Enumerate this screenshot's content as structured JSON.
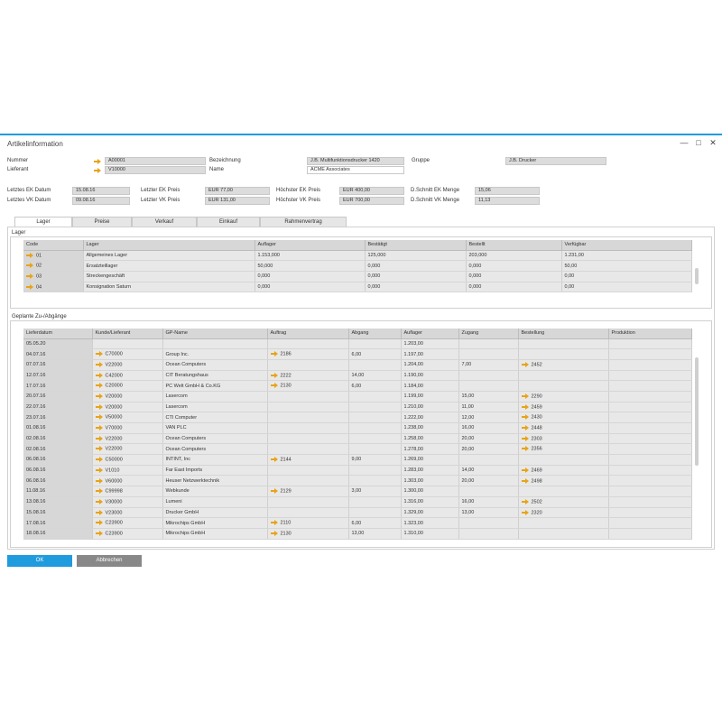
{
  "window": {
    "title": "Artikelinformation"
  },
  "header": {
    "nummer_label": "Nummer",
    "nummer_value": "A00001",
    "lieferant_label": "Lieferant",
    "lieferant_value": "V10000",
    "bezeichnung_label": "Bezeichnung",
    "bezeichnung_value": "J.B. Multifunktionsdrucker 1420",
    "name_label": "Name",
    "name_value": "ACME Associates",
    "gruppe_label": "Gruppe",
    "gruppe_value": "J.B. Drucker"
  },
  "prices": {
    "letztes_ek_datum_label": "Letztes EK Datum",
    "letztes_ek_datum_value": "15.08.16",
    "letztes_vk_datum_label": "Letztes VK Datum",
    "letztes_vk_datum_value": "09.08.16",
    "letzter_ek_preis_label": "Letzter EK Preis",
    "letzter_ek_preis_value": "EUR 77,00",
    "letzter_vk_preis_label": "Letzter VK Preis",
    "letzter_vk_preis_value": "EUR 131,00",
    "hoechster_ek_preis_label": "Höchster EK Preis",
    "hoechster_ek_preis_value": "EUR 400,00",
    "hoechster_vk_preis_label": "Höchster VK Preis",
    "hoechster_vk_preis_value": "EUR 700,00",
    "dschnitt_ek_menge_label": "D.Schnitt EK Menge",
    "dschnitt_ek_menge_value": "15,06",
    "dschnitt_vk_menge_label": "D.Schnitt VK Menge",
    "dschnitt_vk_menge_value": "11,13"
  },
  "tabs": [
    "Lager",
    "Preise",
    "Verkauf",
    "Einkauf",
    "Rahmenvertrag"
  ],
  "lager": {
    "group_label": "Lager",
    "columns": [
      "Code",
      "Lager",
      "Auflager",
      "Bestätigt",
      "Bestellt",
      "Verfügbar"
    ],
    "rows": [
      [
        "01",
        "Allgemeines Lager",
        "1.153,000",
        "125,000",
        "203,000",
        "1.231,00"
      ],
      [
        "02",
        "Ersatzteillager",
        "50,000",
        "0,000",
        "0,000",
        "50,00"
      ],
      [
        "03",
        "Streckengeschäft",
        "0,000",
        "0,000",
        "0,000",
        "0,00"
      ],
      [
        "04",
        "Konsignation Saturn",
        "0,000",
        "0,000",
        "0,000",
        "0,00"
      ]
    ]
  },
  "geplant": {
    "group_label": "Geplante Zu-/Abgänge",
    "columns": [
      "Lieferdatum",
      "Kunde/Lieferant",
      "GP-Name",
      "Auftrag",
      "Abgang",
      "Auflager",
      "Zugang",
      "Bestellung",
      "Produktion"
    ],
    "rows": [
      [
        "05.05.20",
        "",
        "",
        "",
        "",
        "1.203,00",
        "",
        "",
        ""
      ],
      [
        "04.07.16",
        "C70000",
        "Group Inc.",
        "2186",
        "6,00",
        "1.197,00",
        "",
        "",
        ""
      ],
      [
        "07.07.16",
        "V22000",
        "Ocean Computers",
        "",
        "",
        "1.204,00",
        "7,00",
        "2452",
        ""
      ],
      [
        "12.07.16",
        "C42000",
        "CIT Beratungshaus",
        "2222",
        "14,00",
        "1.190,00",
        "",
        "",
        ""
      ],
      [
        "17.07.16",
        "C20000",
        "PC Welt GmbH & Co.KG",
        "2130",
        "6,00",
        "1.184,00",
        "",
        "",
        ""
      ],
      [
        "20.07.16",
        "V20000",
        "Lasercom",
        "",
        "",
        "1.199,00",
        "15,00",
        "2290",
        ""
      ],
      [
        "22.07.16",
        "V20000",
        "Lasercom",
        "",
        "",
        "1.210,00",
        "11,00",
        "2459",
        ""
      ],
      [
        "23.07.16",
        "V50000",
        "CTI Computer",
        "",
        "",
        "1.222,00",
        "12,00",
        "2430",
        ""
      ],
      [
        "01.08.16",
        "V70000",
        "VAN PLC",
        "",
        "",
        "1.238,00",
        "16,00",
        "2448",
        ""
      ],
      [
        "02.08.16",
        "V22000",
        "Ocean Computers",
        "",
        "",
        "1.258,00",
        "20,00",
        "2303",
        ""
      ],
      [
        "02.08.16",
        "V22000",
        "Ocean Computers",
        "",
        "",
        "1.278,00",
        "20,00",
        "2356",
        ""
      ],
      [
        "06.08.16",
        "C50000",
        "INTINT, Inc",
        "2144",
        "9,00",
        "1.269,00",
        "",
        "",
        ""
      ],
      [
        "06.08.16",
        "V1010",
        "Far East Imports",
        "",
        "",
        "1.283,00",
        "14,00",
        "2469",
        ""
      ],
      [
        "06.08.16",
        "V60000",
        "Heuser Netzwerktechnik",
        "",
        "",
        "1.303,00",
        "20,00",
        "2498",
        ""
      ],
      [
        "11.08.16",
        "C99998",
        "Webkunde",
        "2129",
        "3,00",
        "1.300,00",
        "",
        "",
        ""
      ],
      [
        "13.08.16",
        "V30000",
        "Lumeni",
        "",
        "",
        "1.316,00",
        "16,00",
        "2502",
        ""
      ],
      [
        "15.08.16",
        "V23000",
        "Drucker GmbH",
        "",
        "",
        "1.329,00",
        "13,00",
        "2320",
        ""
      ],
      [
        "17.08.16",
        "C23900",
        "Mikrochips GmbH",
        "2110",
        "6,00",
        "1.323,00",
        "",
        "",
        ""
      ],
      [
        "18.08.16",
        "C23900",
        "Mikrochips GmbH",
        "2130",
        "13,00",
        "1.310,00",
        "",
        "",
        ""
      ]
    ]
  },
  "buttons": {
    "ok": "OK",
    "cancel": "Abbrechen"
  },
  "colors": {
    "accent": "#1f9bde",
    "link_arrow": "#e8a317",
    "cancel": "#888888"
  }
}
